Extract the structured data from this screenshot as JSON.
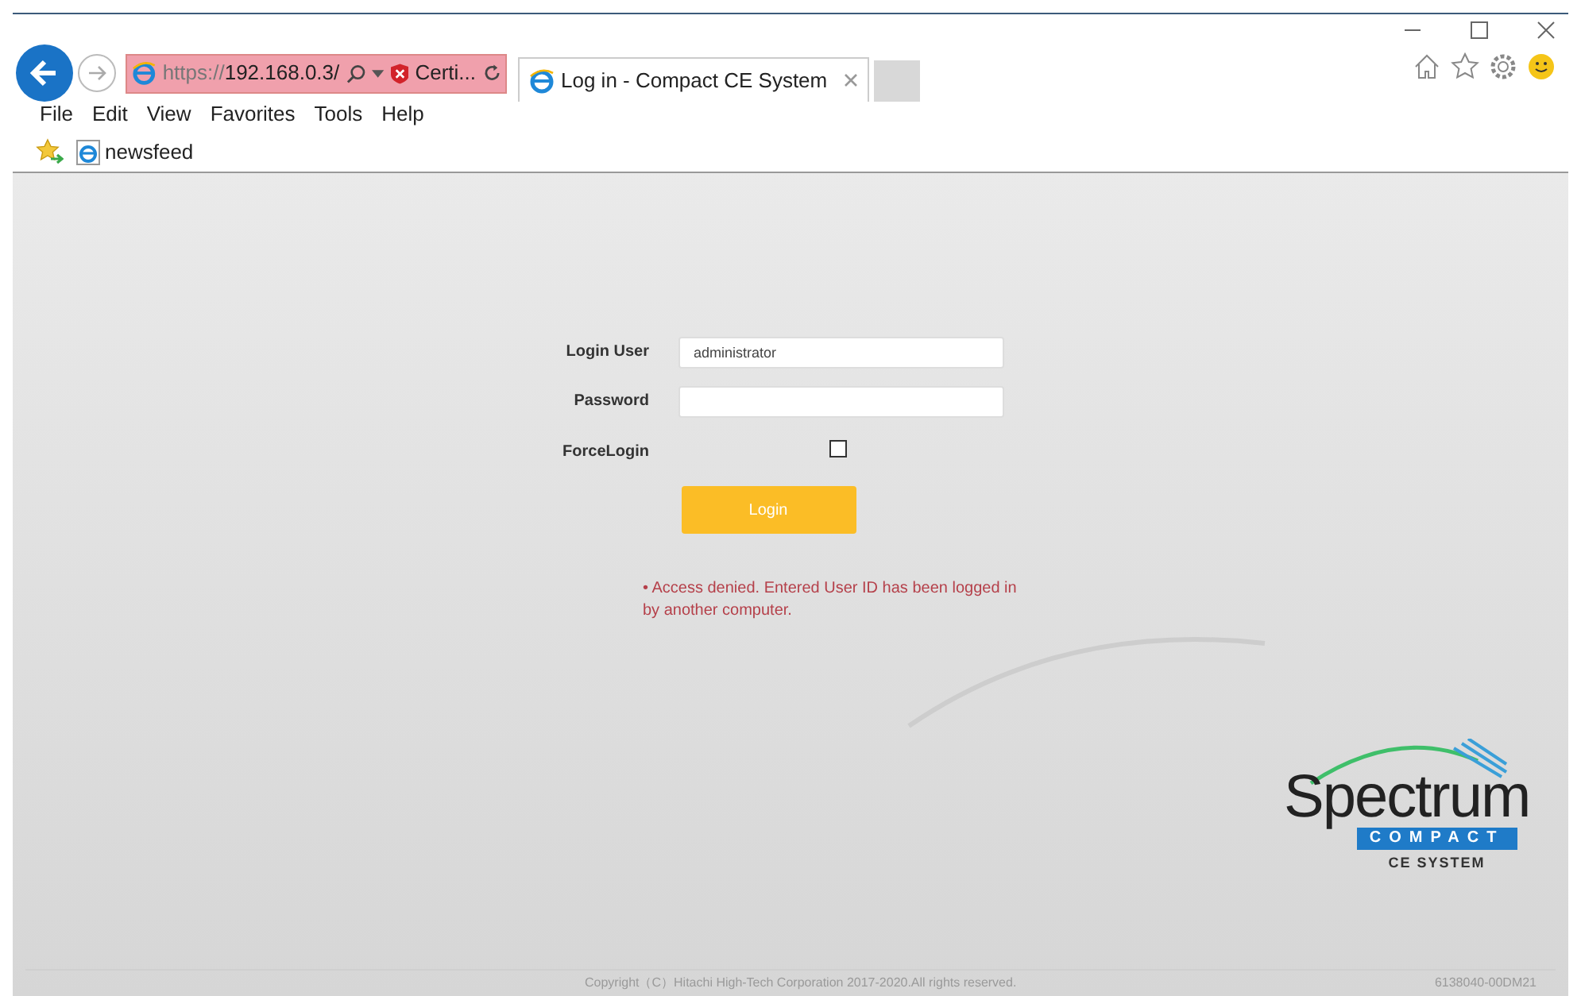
{
  "address_bar": {
    "url_prefix": "https://",
    "url_host": "192.168.0.3/",
    "certificate": "Certi..."
  },
  "tabs": [
    {
      "label": "Log in - Compact CE System",
      "selected": true
    }
  ],
  "menu": [
    "File",
    "Edit",
    "View",
    "Favorites",
    "Tools",
    "Help"
  ],
  "favorites_bar": [
    {
      "label": "newsfeed"
    }
  ],
  "login_form": {
    "fields": [
      {
        "label": "Login User",
        "value": "administrator",
        "kind": "text"
      },
      {
        "label": "Password",
        "kind": "password"
      }
    ],
    "force_login": {
      "label": "ForceLogin",
      "checked": false
    },
    "button": "Login",
    "error": "• Access denied. Entered User ID has been logged in by another computer."
  },
  "logo": {
    "name": "Spectrum",
    "badge": "COMPACT",
    "subtitle": "CE SYSTEM"
  },
  "footer": {
    "copyright": "Copyright（C）Hitachi High-Tech Corporation 2017-2020.All rights reserved.",
    "version": "6138040-00DM21"
  }
}
